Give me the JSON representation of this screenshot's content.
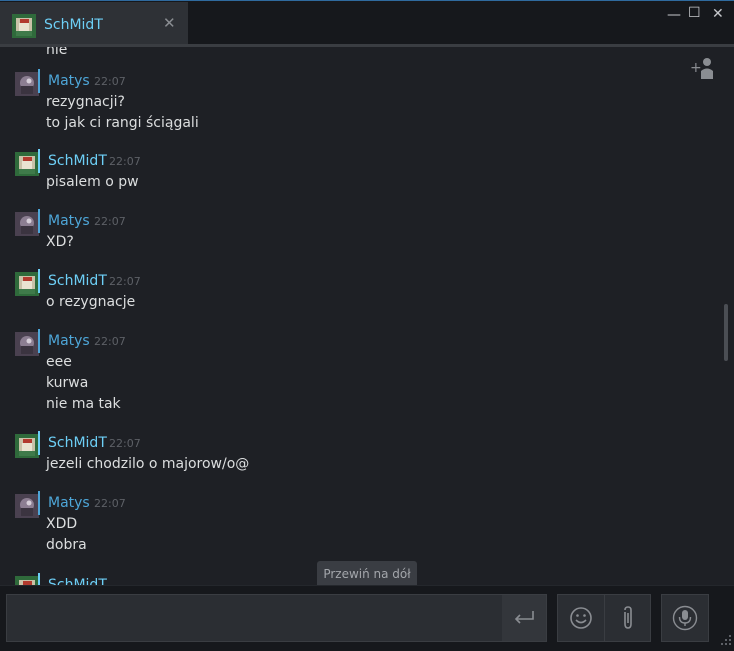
{
  "tab": {
    "name": "SchMidT",
    "close": "✕"
  },
  "window": {
    "minimize": "—",
    "maximize": "☐",
    "close": "✕"
  },
  "chat": {
    "cut_top_line": "nie",
    "messages": [
      {
        "author": "Matys",
        "time": "22:07",
        "lines": [
          "rezygnacji?",
          "to jak ci rangi ściągali"
        ]
      },
      {
        "author": "SchMidT",
        "time": "22:07",
        "lines": [
          "pisalem o pw"
        ]
      },
      {
        "author": "Matys",
        "time": "22:07",
        "lines": [
          "XD?"
        ]
      },
      {
        "author": "SchMidT",
        "time": "22:07",
        "lines": [
          "o rezygnacje"
        ]
      },
      {
        "author": "Matys",
        "time": "22:07",
        "lines": [
          "eee",
          "kurwa",
          "nie ma tak"
        ]
      },
      {
        "author": "SchMidT",
        "time": "22:07",
        "lines": [
          "jezeli chodzilo o majorow/o@"
        ]
      },
      {
        "author": "Matys",
        "time": "22:07",
        "lines": [
          "XDD",
          "dobra"
        ]
      },
      {
        "author": "SchMidT",
        "time": "",
        "lines": []
      }
    ]
  },
  "jump_label": "Przewiń na dół",
  "input": {
    "value": "",
    "placeholder": ""
  },
  "icons": {
    "send": "enter-icon",
    "emoji": "smiley-icon",
    "attach": "paperclip-icon",
    "voice": "microphone-icon",
    "add_friend": "add-friend-icon"
  },
  "colors": {
    "accent": "#6dcff6",
    "matys_name": "#4ea6d8",
    "schmidt_bar": "#6dcff6",
    "matys_bar": "#4ea6d8"
  }
}
